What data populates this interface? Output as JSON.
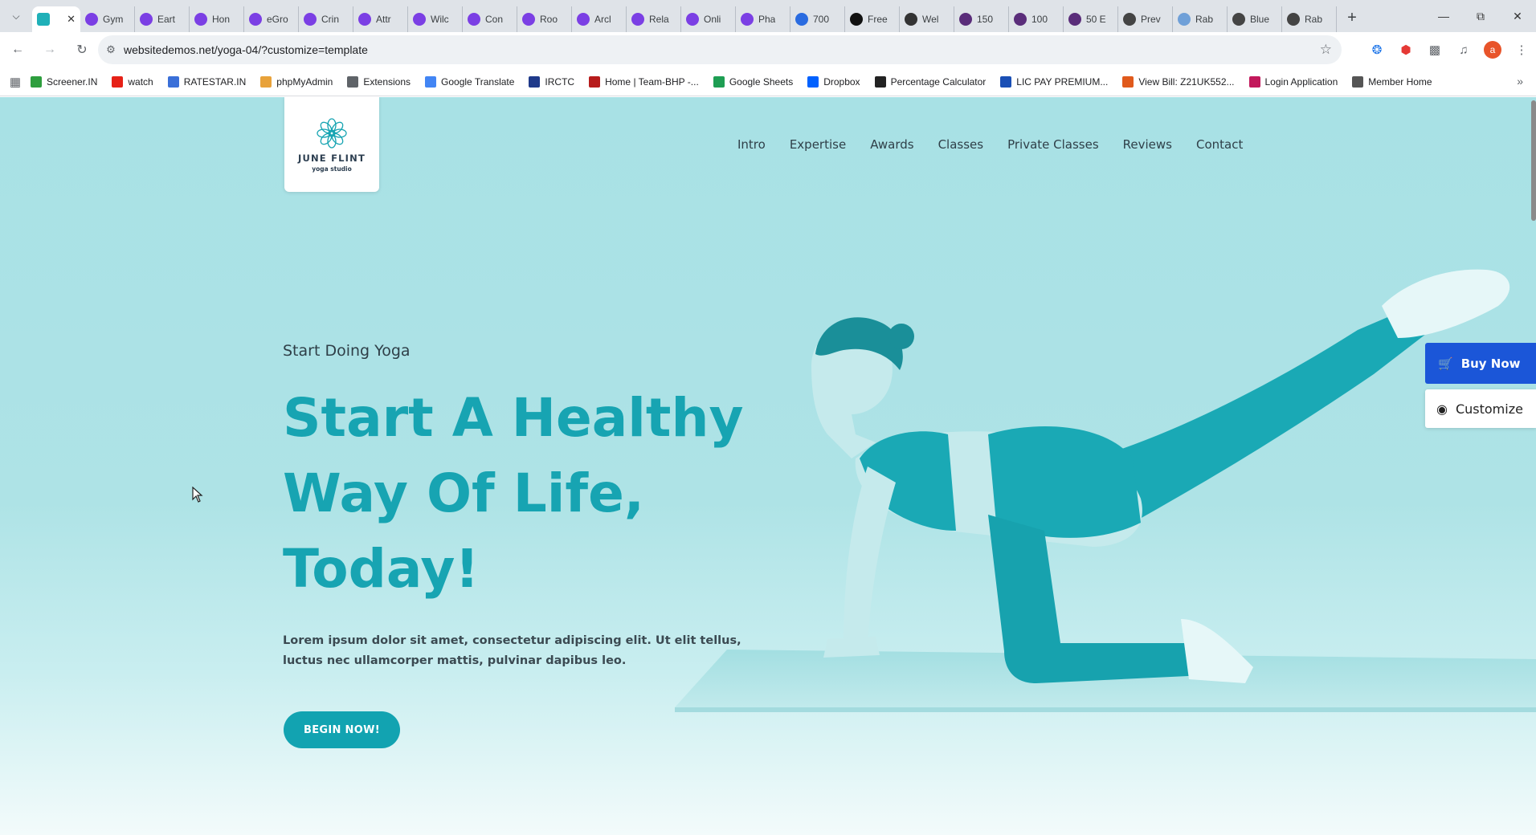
{
  "browser": {
    "tabs": [
      {
        "title": "",
        "active": true,
        "favicon_color": "#1fb0b8"
      },
      {
        "title": "Gym",
        "favicon_color": "#7b3fe4"
      },
      {
        "title": "Eart",
        "favicon_color": "#7b3fe4"
      },
      {
        "title": "Hon",
        "favicon_color": "#7b3fe4"
      },
      {
        "title": "eGro",
        "favicon_color": "#7b3fe4"
      },
      {
        "title": "Crin",
        "favicon_color": "#7b3fe4"
      },
      {
        "title": "Attr",
        "favicon_color": "#7b3fe4"
      },
      {
        "title": "Wilc",
        "favicon_color": "#7b3fe4"
      },
      {
        "title": "Con",
        "favicon_color": "#7b3fe4"
      },
      {
        "title": "Roo",
        "favicon_color": "#7b3fe4"
      },
      {
        "title": "Arcl",
        "favicon_color": "#7b3fe4"
      },
      {
        "title": "Rela",
        "favicon_color": "#7b3fe4"
      },
      {
        "title": "Onli",
        "favicon_color": "#7b3fe4"
      },
      {
        "title": "Pha",
        "favicon_color": "#7b3fe4"
      },
      {
        "title": "700",
        "favicon_color": "#2a6be0"
      },
      {
        "title": "Free",
        "favicon_color": "#111111"
      },
      {
        "title": "Wel",
        "favicon_color": "#333333"
      },
      {
        "title": "150",
        "favicon_color": "#5a2d7a"
      },
      {
        "title": "100",
        "favicon_color": "#5a2d7a"
      },
      {
        "title": "50 E",
        "favicon_color": "#5a2d7a"
      },
      {
        "title": "Prev",
        "favicon_color": "#444444"
      },
      {
        "title": "Rab",
        "favicon_color": "#6fa0d8"
      },
      {
        "title": "Blue",
        "favicon_color": "#444444"
      },
      {
        "title": "Rab",
        "favicon_color": "#444444"
      }
    ],
    "url": "websitedemos.net/yoga-04/?customize=template",
    "profile_initial": "a",
    "bookmarks": [
      {
        "label": "Screener.IN",
        "color": "#2e9e3e"
      },
      {
        "label": "watch",
        "color": "#e62117"
      },
      {
        "label": "RATESTAR.IN",
        "color": "#3a6fd8"
      },
      {
        "label": "phpMyAdmin",
        "color": "#e8a23a"
      },
      {
        "label": "Extensions",
        "color": "#5f6368"
      },
      {
        "label": "Google Translate",
        "color": "#4285f4"
      },
      {
        "label": "IRCTC",
        "color": "#1f3a8a"
      },
      {
        "label": "Home | Team-BHP -...",
        "color": "#b71c1c"
      },
      {
        "label": "Google Sheets",
        "color": "#1e9e53"
      },
      {
        "label": "Dropbox",
        "color": "#0061fe"
      },
      {
        "label": "Percentage Calculator",
        "color": "#222222"
      },
      {
        "label": "LIC PAY PREMIUM...",
        "color": "#1a4fb5"
      },
      {
        "label": "View Bill: Z21UK552...",
        "color": "#e05a1c"
      },
      {
        "label": "Login Application",
        "color": "#c2185b"
      },
      {
        "label": "Member Home",
        "color": "#555555"
      }
    ]
  },
  "site": {
    "logo": {
      "name": "JUNE FLINT",
      "sub": "yoga studio"
    },
    "nav": [
      "Intro",
      "Expertise",
      "Awards",
      "Classes",
      "Private Classes",
      "Reviews",
      "Contact"
    ],
    "hero": {
      "eyebrow": "Start Doing Yoga",
      "headline": "Start A Healthy Way Of Life, Today!",
      "lead": "Lorem ipsum dolor sit amet, consectetur adipiscing elit. Ut elit tellus, luctus nec ullamcorper mattis, pulvinar dapibus leo.",
      "cta": "BEGIN NOW!"
    },
    "side_buttons": {
      "buy": "Buy Now",
      "customize": "Customize"
    }
  },
  "colors": {
    "accent": "#17a4b2",
    "buy_button": "#1b56d8",
    "hero_bg": "#a8e1e5"
  }
}
